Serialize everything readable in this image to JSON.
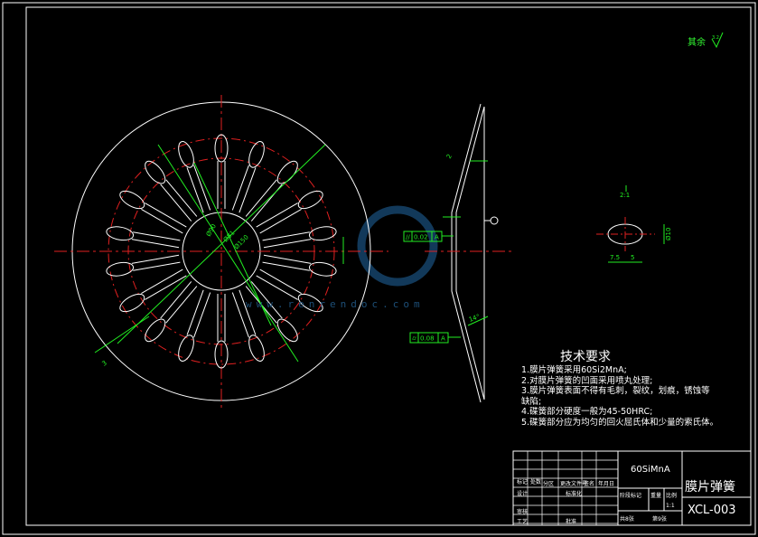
{
  "drawing": {
    "roughness_label": "其余",
    "roughness_value": "3.2",
    "notes_title": "技术要求",
    "notes": [
      "1.膜片弹簧采用60Si2MnA;",
      "2.对膜片弹簧的凹面采用喷丸处理;",
      "3.膜片弹簧表面不得有毛刺，裂纹，划痕，锈蚀等",
      "缺陷;",
      "4.碟簧部分硬度一般为45-50HRC;",
      "5.碟簧部分应为均匀的回火屈氏体和少量的索氏体。"
    ],
    "tolerance_1": {
      "symbol": "//",
      "value": "0.02",
      "datum": "A"
    },
    "tolerance_2": {
      "symbol": "⌭",
      "value": "0.08",
      "datum": "A"
    },
    "detail_scale": "2:1",
    "dims": {
      "d1": "Ø150",
      "d2": "Ø81",
      "d3": "Ø90",
      "d4": "Ø10",
      "d5": "7.5",
      "d6": "5",
      "d7": "2",
      "d8": "14°",
      "d9": "3"
    }
  },
  "title_block": {
    "material": "60SiMnA",
    "part_name": "膜片弹簧",
    "drawing_code": "XCL-003",
    "labels": [
      "标记",
      "处数",
      "分区",
      "更改文件号",
      "签名",
      "年月日",
      "设计",
      "标准化",
      "审核",
      "工艺",
      "批准",
      "阶段标记",
      "重量",
      "比例",
      "共8张",
      "第9张"
    ],
    "scale": "1:1"
  },
  "watermark": "www.renrendoc.com"
}
